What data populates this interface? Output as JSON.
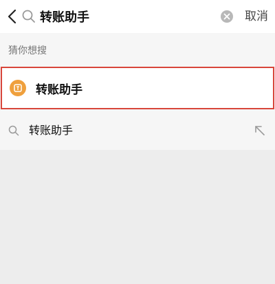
{
  "search": {
    "value": "转账助手",
    "cancel_label": "取消"
  },
  "guess": {
    "heading": "猜你想搜",
    "suggestion": {
      "label": "转账助手",
      "icon": "transfer-assistant-app-icon",
      "icon_color": "#efa03d"
    }
  },
  "history": {
    "items": [
      {
        "label": "转账助手",
        "icon": "search-icon",
        "action_icon": "arrow-up-left-icon"
      }
    ]
  },
  "colors": {
    "highlight_border": "#d8453a",
    "background": "#ededed",
    "panel": "#f6f6f6"
  }
}
